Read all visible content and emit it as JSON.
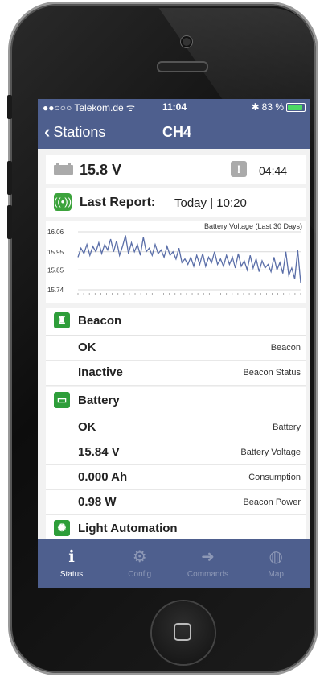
{
  "status_bar": {
    "carrier": "●●○○○ Telekom.de ᯤ",
    "time": "11:04",
    "battery": "83 %"
  },
  "nav": {
    "back_label": "Stations",
    "title": "CH4"
  },
  "summary": {
    "voltage": "15.8 V",
    "duration": "04:44"
  },
  "last_report": {
    "label": "Last Report:",
    "value": "Today | 10:20"
  },
  "chart_data": {
    "type": "line",
    "title": "Battery Voltage (Last 30 Days)",
    "yticks": [
      "16.06",
      "15.95",
      "15.85",
      "15.74"
    ],
    "ylim": [
      15.74,
      16.06
    ],
    "series": [
      {
        "values": [
          15.92,
          15.97,
          15.94,
          15.99,
          15.93,
          15.98,
          15.95,
          16.0,
          15.94,
          15.99,
          15.96,
          16.02,
          15.95,
          16.01,
          15.93,
          15.98,
          16.04,
          15.94,
          16.0,
          15.95,
          15.99,
          15.93,
          16.03,
          15.95,
          15.97,
          15.93,
          15.99,
          15.94,
          15.96,
          15.92,
          15.98,
          15.93,
          15.95,
          15.91,
          15.97,
          15.89,
          15.91,
          15.88,
          15.92,
          15.87,
          15.93,
          15.88,
          15.94,
          15.87,
          15.92,
          15.89,
          15.95,
          15.88,
          15.91,
          15.87,
          15.93,
          15.88,
          15.92,
          15.86,
          15.94,
          15.87,
          15.9,
          15.85,
          15.93,
          15.86,
          15.91,
          15.84,
          15.9,
          15.86,
          15.88,
          15.84,
          15.92,
          15.85,
          15.89,
          15.83,
          15.95,
          15.82,
          15.86,
          15.8,
          15.96,
          15.78
        ]
      }
    ],
    "grid": true
  },
  "sections": [
    {
      "title": "Beacon",
      "icon": "beacon-icon",
      "rows": [
        {
          "value": "OK",
          "label": "Beacon"
        },
        {
          "value": "Inactive",
          "label": "Beacon Status"
        }
      ]
    },
    {
      "title": "Battery",
      "icon": "battery-icon",
      "rows": [
        {
          "value": "OK",
          "label": "Battery"
        },
        {
          "value": "15.84 V",
          "label": "Battery Voltage"
        },
        {
          "value": "0.000 Ah",
          "label": "Consumption"
        },
        {
          "value": "0.98 W",
          "label": "Beacon Power"
        }
      ]
    },
    {
      "title": "Light Automation",
      "icon": "light-icon",
      "rows": []
    }
  ],
  "tabs": [
    {
      "label": "Status",
      "active": true
    },
    {
      "label": "Config",
      "active": false
    },
    {
      "label": "Commands",
      "active": false
    },
    {
      "label": "Map",
      "active": false
    }
  ],
  "colors": {
    "bar": "#4e5f8e",
    "accent_green": "#2e9e3a",
    "line": "#5a6ea8"
  }
}
